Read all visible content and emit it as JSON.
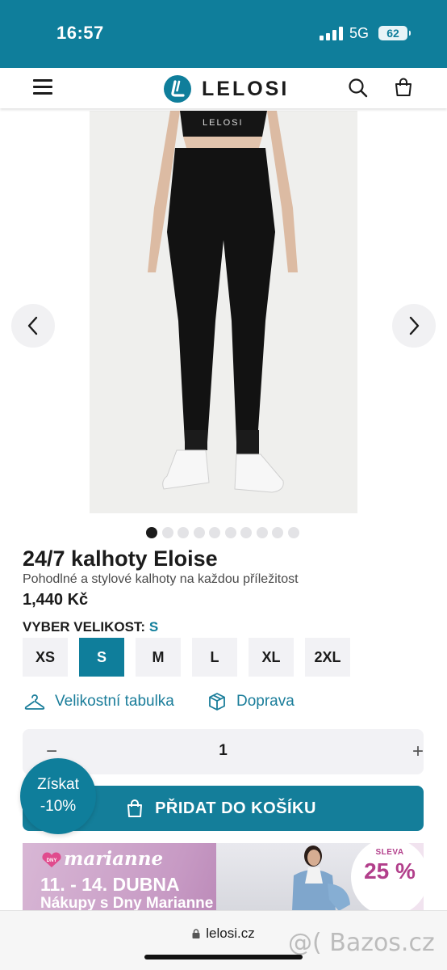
{
  "status_bar": {
    "time": "16:57",
    "network": "5G",
    "battery": "62"
  },
  "header": {
    "brand": "LELOSI",
    "icons": [
      "menu-icon",
      "search-icon",
      "shopping-bag-icon"
    ]
  },
  "product": {
    "title": "24/7 kalhoty Eloise",
    "subtitle": "Pohodlné a stylové kalhoty na každou příležitost",
    "price": "1,440 Kč",
    "image_count": 10,
    "active_image_index": 0
  },
  "size_picker": {
    "label": "VYBER VELIKOST:",
    "selected": "S",
    "options": [
      "XS",
      "S",
      "M",
      "L",
      "XL",
      "2XL"
    ]
  },
  "links": {
    "size_table": "Velikostní tabulka",
    "shipping": "Doprava"
  },
  "quantity": {
    "minus": "−",
    "value": "1",
    "plus": "+"
  },
  "cart": {
    "add_label": "PŘIDAT DO KOŠÍKU"
  },
  "discount_badge": {
    "line1": "Získat",
    "line2": "-10%"
  },
  "banner": {
    "badge": "DNY",
    "brand": "marianne",
    "dates": "11. - 14. DUBNA",
    "subtitle": "Nákupy s Dny Marianne",
    "sale_label": "SLEVA",
    "sale_value": "25 %"
  },
  "browser": {
    "url": "lelosi.cz"
  },
  "watermark": "@( Bazos.cz",
  "colors": {
    "brand": "#0f7e9b",
    "link": "#1a7d9a",
    "banner_accent": "#b23f8b"
  }
}
